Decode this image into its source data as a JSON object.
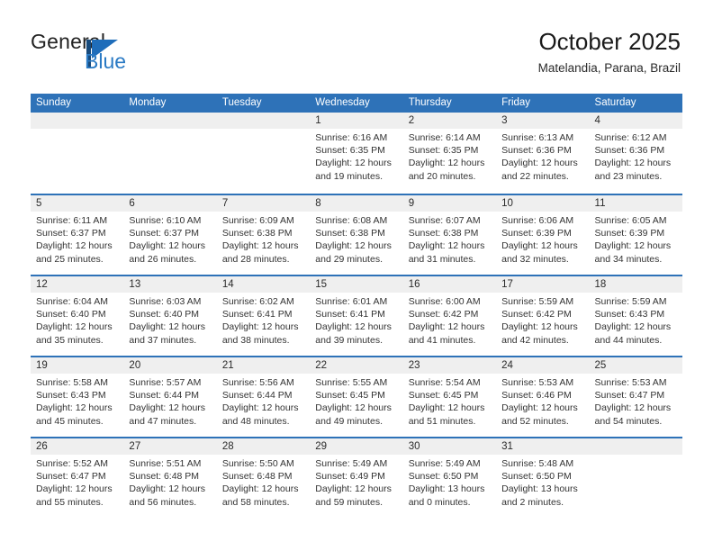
{
  "brand": {
    "name_part1": "General",
    "name_part2": "Blue",
    "logo_dark": "#174a7c",
    "logo_light": "#1f6dba"
  },
  "header": {
    "month_title": "October 2025",
    "location": "Matelandia, Parana, Brazil"
  },
  "theme": {
    "header_blue": "#2e72b8",
    "band_gray": "#efefef"
  },
  "weekdays": [
    "Sunday",
    "Monday",
    "Tuesday",
    "Wednesday",
    "Thursday",
    "Friday",
    "Saturday"
  ],
  "weeks": [
    [
      {
        "day": "",
        "sunrise": "",
        "sunset": "",
        "daylight1": "",
        "daylight2": ""
      },
      {
        "day": "",
        "sunrise": "",
        "sunset": "",
        "daylight1": "",
        "daylight2": ""
      },
      {
        "day": "",
        "sunrise": "",
        "sunset": "",
        "daylight1": "",
        "daylight2": ""
      },
      {
        "day": "1",
        "sunrise": "Sunrise: 6:16 AM",
        "sunset": "Sunset: 6:35 PM",
        "daylight1": "Daylight: 12 hours",
        "daylight2": "and 19 minutes."
      },
      {
        "day": "2",
        "sunrise": "Sunrise: 6:14 AM",
        "sunset": "Sunset: 6:35 PM",
        "daylight1": "Daylight: 12 hours",
        "daylight2": "and 20 minutes."
      },
      {
        "day": "3",
        "sunrise": "Sunrise: 6:13 AM",
        "sunset": "Sunset: 6:36 PM",
        "daylight1": "Daylight: 12 hours",
        "daylight2": "and 22 minutes."
      },
      {
        "day": "4",
        "sunrise": "Sunrise: 6:12 AM",
        "sunset": "Sunset: 6:36 PM",
        "daylight1": "Daylight: 12 hours",
        "daylight2": "and 23 minutes."
      }
    ],
    [
      {
        "day": "5",
        "sunrise": "Sunrise: 6:11 AM",
        "sunset": "Sunset: 6:37 PM",
        "daylight1": "Daylight: 12 hours",
        "daylight2": "and 25 minutes."
      },
      {
        "day": "6",
        "sunrise": "Sunrise: 6:10 AM",
        "sunset": "Sunset: 6:37 PM",
        "daylight1": "Daylight: 12 hours",
        "daylight2": "and 26 minutes."
      },
      {
        "day": "7",
        "sunrise": "Sunrise: 6:09 AM",
        "sunset": "Sunset: 6:38 PM",
        "daylight1": "Daylight: 12 hours",
        "daylight2": "and 28 minutes."
      },
      {
        "day": "8",
        "sunrise": "Sunrise: 6:08 AM",
        "sunset": "Sunset: 6:38 PM",
        "daylight1": "Daylight: 12 hours",
        "daylight2": "and 29 minutes."
      },
      {
        "day": "9",
        "sunrise": "Sunrise: 6:07 AM",
        "sunset": "Sunset: 6:38 PM",
        "daylight1": "Daylight: 12 hours",
        "daylight2": "and 31 minutes."
      },
      {
        "day": "10",
        "sunrise": "Sunrise: 6:06 AM",
        "sunset": "Sunset: 6:39 PM",
        "daylight1": "Daylight: 12 hours",
        "daylight2": "and 32 minutes."
      },
      {
        "day": "11",
        "sunrise": "Sunrise: 6:05 AM",
        "sunset": "Sunset: 6:39 PM",
        "daylight1": "Daylight: 12 hours",
        "daylight2": "and 34 minutes."
      }
    ],
    [
      {
        "day": "12",
        "sunrise": "Sunrise: 6:04 AM",
        "sunset": "Sunset: 6:40 PM",
        "daylight1": "Daylight: 12 hours",
        "daylight2": "and 35 minutes."
      },
      {
        "day": "13",
        "sunrise": "Sunrise: 6:03 AM",
        "sunset": "Sunset: 6:40 PM",
        "daylight1": "Daylight: 12 hours",
        "daylight2": "and 37 minutes."
      },
      {
        "day": "14",
        "sunrise": "Sunrise: 6:02 AM",
        "sunset": "Sunset: 6:41 PM",
        "daylight1": "Daylight: 12 hours",
        "daylight2": "and 38 minutes."
      },
      {
        "day": "15",
        "sunrise": "Sunrise: 6:01 AM",
        "sunset": "Sunset: 6:41 PM",
        "daylight1": "Daylight: 12 hours",
        "daylight2": "and 39 minutes."
      },
      {
        "day": "16",
        "sunrise": "Sunrise: 6:00 AM",
        "sunset": "Sunset: 6:42 PM",
        "daylight1": "Daylight: 12 hours",
        "daylight2": "and 41 minutes."
      },
      {
        "day": "17",
        "sunrise": "Sunrise: 5:59 AM",
        "sunset": "Sunset: 6:42 PM",
        "daylight1": "Daylight: 12 hours",
        "daylight2": "and 42 minutes."
      },
      {
        "day": "18",
        "sunrise": "Sunrise: 5:59 AM",
        "sunset": "Sunset: 6:43 PM",
        "daylight1": "Daylight: 12 hours",
        "daylight2": "and 44 minutes."
      }
    ],
    [
      {
        "day": "19",
        "sunrise": "Sunrise: 5:58 AM",
        "sunset": "Sunset: 6:43 PM",
        "daylight1": "Daylight: 12 hours",
        "daylight2": "and 45 minutes."
      },
      {
        "day": "20",
        "sunrise": "Sunrise: 5:57 AM",
        "sunset": "Sunset: 6:44 PM",
        "daylight1": "Daylight: 12 hours",
        "daylight2": "and 47 minutes."
      },
      {
        "day": "21",
        "sunrise": "Sunrise: 5:56 AM",
        "sunset": "Sunset: 6:44 PM",
        "daylight1": "Daylight: 12 hours",
        "daylight2": "and 48 minutes."
      },
      {
        "day": "22",
        "sunrise": "Sunrise: 5:55 AM",
        "sunset": "Sunset: 6:45 PM",
        "daylight1": "Daylight: 12 hours",
        "daylight2": "and 49 minutes."
      },
      {
        "day": "23",
        "sunrise": "Sunrise: 5:54 AM",
        "sunset": "Sunset: 6:45 PM",
        "daylight1": "Daylight: 12 hours",
        "daylight2": "and 51 minutes."
      },
      {
        "day": "24",
        "sunrise": "Sunrise: 5:53 AM",
        "sunset": "Sunset: 6:46 PM",
        "daylight1": "Daylight: 12 hours",
        "daylight2": "and 52 minutes."
      },
      {
        "day": "25",
        "sunrise": "Sunrise: 5:53 AM",
        "sunset": "Sunset: 6:47 PM",
        "daylight1": "Daylight: 12 hours",
        "daylight2": "and 54 minutes."
      }
    ],
    [
      {
        "day": "26",
        "sunrise": "Sunrise: 5:52 AM",
        "sunset": "Sunset: 6:47 PM",
        "daylight1": "Daylight: 12 hours",
        "daylight2": "and 55 minutes."
      },
      {
        "day": "27",
        "sunrise": "Sunrise: 5:51 AM",
        "sunset": "Sunset: 6:48 PM",
        "daylight1": "Daylight: 12 hours",
        "daylight2": "and 56 minutes."
      },
      {
        "day": "28",
        "sunrise": "Sunrise: 5:50 AM",
        "sunset": "Sunset: 6:48 PM",
        "daylight1": "Daylight: 12 hours",
        "daylight2": "and 58 minutes."
      },
      {
        "day": "29",
        "sunrise": "Sunrise: 5:49 AM",
        "sunset": "Sunset: 6:49 PM",
        "daylight1": "Daylight: 12 hours",
        "daylight2": "and 59 minutes."
      },
      {
        "day": "30",
        "sunrise": "Sunrise: 5:49 AM",
        "sunset": "Sunset: 6:50 PM",
        "daylight1": "Daylight: 13 hours",
        "daylight2": "and 0 minutes."
      },
      {
        "day": "31",
        "sunrise": "Sunrise: 5:48 AM",
        "sunset": "Sunset: 6:50 PM",
        "daylight1": "Daylight: 13 hours",
        "daylight2": "and 2 minutes."
      },
      {
        "day": "",
        "sunrise": "",
        "sunset": "",
        "daylight1": "",
        "daylight2": ""
      }
    ]
  ]
}
